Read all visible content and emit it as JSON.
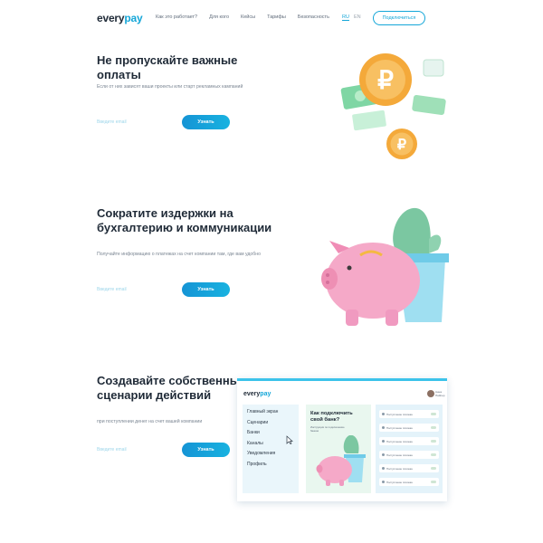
{
  "header": {
    "logo_main": "every",
    "logo_accent": "pay",
    "nav": [
      "Как это работает?",
      "Для кого",
      "Кейсы",
      "Тарифы",
      "Безопасность"
    ],
    "lang": [
      "RU",
      "EN"
    ],
    "connect_button": "Подключиться"
  },
  "sections": [
    {
      "title": "Не пропускайте важные оплаты",
      "subtitle": "Если от них зависят ваши проекты или старт рекламных кампаний",
      "input_placeholder": "Введите email",
      "cta": "Узнать"
    },
    {
      "title": "Сократите издержки на бухгалтерию и коммуникации",
      "subtitle": "Получайте информацию о платежах на счет компании там, где вам удобно",
      "input_placeholder": "Введите email",
      "cta": "Узнать"
    },
    {
      "title": "Создавайте собственные сценарии действий",
      "subtitle": "при поступлении денег на счет вашей компании",
      "input_placeholder": "Введите email",
      "cta": "Узнать"
    }
  ],
  "mockup": {
    "logo_main": "every",
    "logo_accent": "pay",
    "user_name": "Анна Пайпер",
    "menu": [
      "Главный экран",
      "Сценарии",
      "Банки",
      "Каналы",
      "Уведомления",
      "Профиль"
    ],
    "promo_title": "Как подключить свой банк?",
    "promo_text": "Инструкция по подключению банков",
    "rows": [
      "Поступление платежа",
      "Поступление платежа",
      "Поступление платежа",
      "Поступление платежа",
      "Поступление платежа",
      "Поступление платежа"
    ]
  },
  "icons": {
    "coin": "ruble-coin-icon",
    "banknote": "banknote-icon",
    "piggy": "piggy-bank-icon",
    "cactus": "cactus-icon",
    "cursor": "cursor-icon"
  },
  "colors": {
    "accent": "#14a6d8",
    "coin": "#f4a93a",
    "piggy": "#f5a9c8",
    "cactus": "#7bc7a1"
  }
}
